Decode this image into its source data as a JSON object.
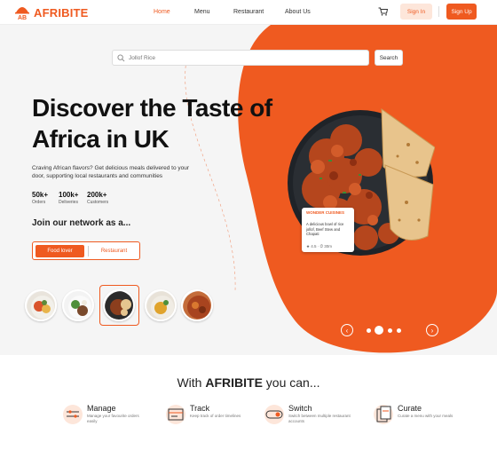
{
  "brand": {
    "name": "AFRIBITE",
    "mark": "AB"
  },
  "nav": {
    "home": "Home",
    "menu": "Menu",
    "restaurant": "Restaurant",
    "about": "About Us",
    "sign_in": "Sign In",
    "sign_up": "Sign Up"
  },
  "search": {
    "placeholder": "Jollof Rice",
    "button": "Search"
  },
  "hero": {
    "headline": "Discover the Taste of Africa in UK",
    "tagline": "Craving African flavors? Get delicious meals delivered to your door, supporting local restaurants and communities",
    "stats": [
      {
        "num": "50k+",
        "label": "Orders"
      },
      {
        "num": "100k+",
        "label": "Deliveries"
      },
      {
        "num": "200k+",
        "label": "Customers"
      }
    ],
    "join": "Join our network as a...",
    "toggle": {
      "primary": "Food lover",
      "secondary": "Restaurant"
    },
    "card": {
      "title": "WONDER CUISINES",
      "desc": "A delicious bowl of rice jollof, Beef Stew and Chapati",
      "rating": "★ 4.5  ·  ⏱ 30m"
    },
    "carousel": {
      "active_index": 1,
      "count": 4
    }
  },
  "colors": {
    "accent": "#ef5a20",
    "accent_light": "#fde6da"
  },
  "features_title_pre": "With ",
  "features_title_brand": "AFRIBITE",
  "features_title_post": " you can...",
  "features": [
    {
      "icon": "manage-icon",
      "title": "Manage",
      "desc": "Manage your favourite orders easily"
    },
    {
      "icon": "track-icon",
      "title": "Track",
      "desc": "Keep track of order timelines"
    },
    {
      "icon": "switch-icon",
      "title": "Switch",
      "desc": "Switch between multiple restaurant accounts"
    },
    {
      "icon": "curate-icon",
      "title": "Curate",
      "desc": "Curate a menu with your meals"
    }
  ]
}
